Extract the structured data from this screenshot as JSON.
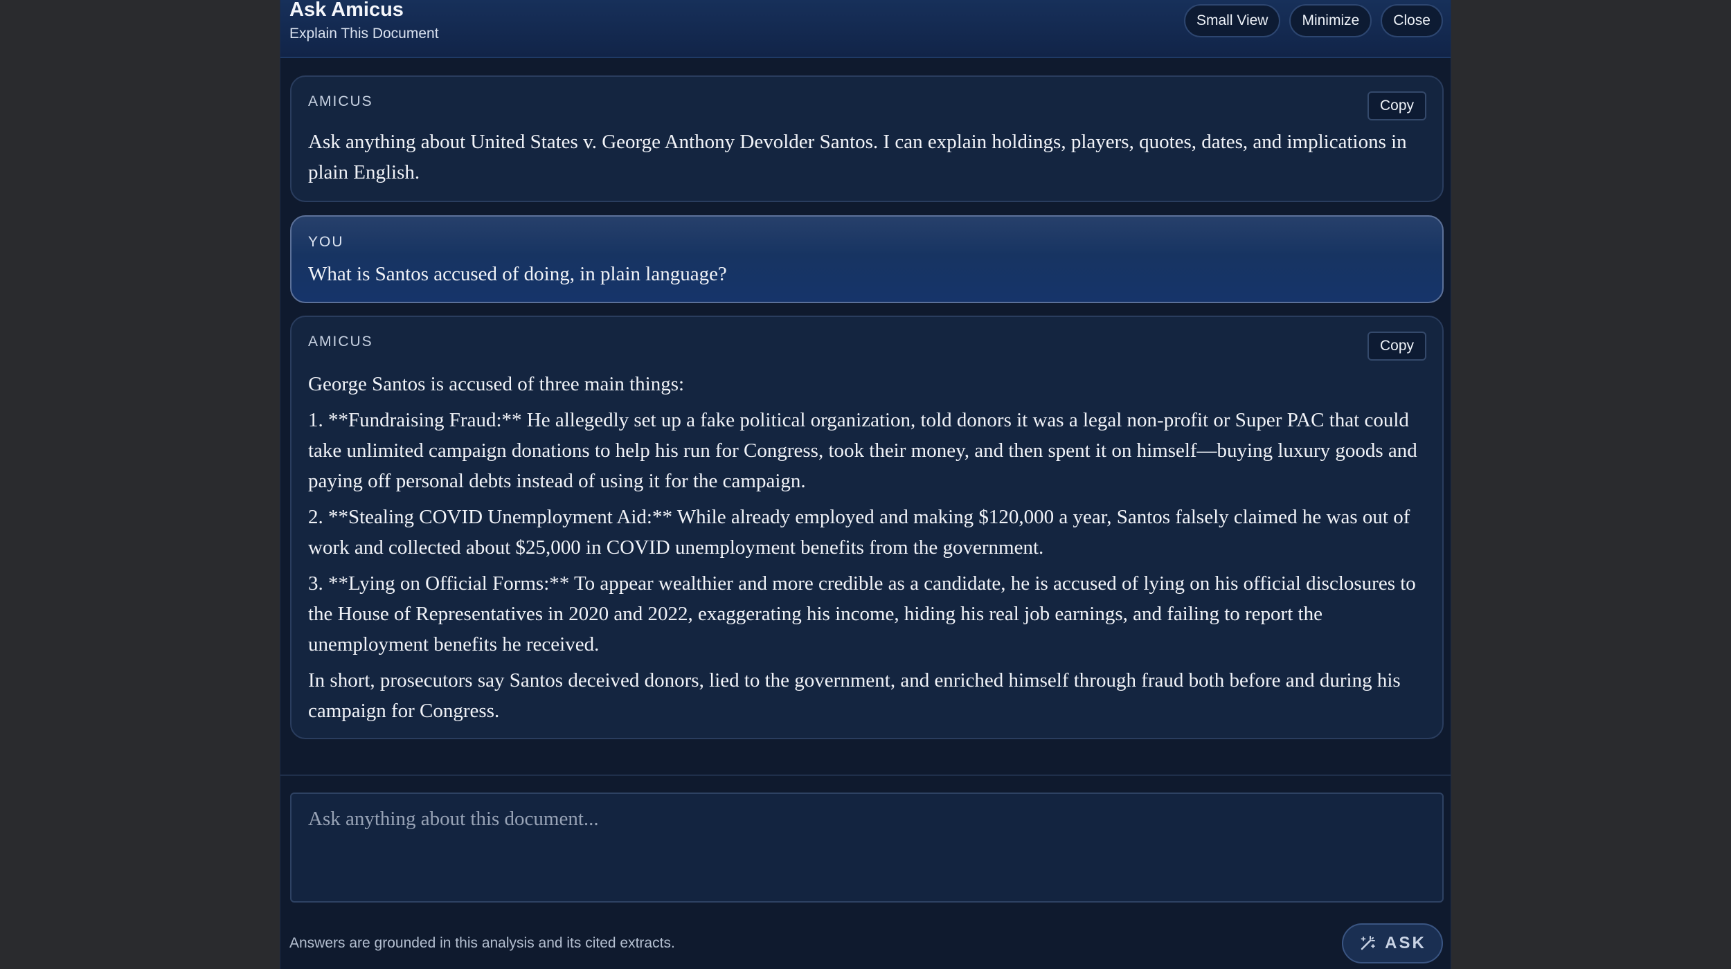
{
  "header": {
    "title": "Ask Amicus",
    "subtitle": "Explain This Document",
    "buttons": {
      "small_view": "Small View",
      "minimize": "Minimize",
      "close": "Close"
    }
  },
  "messages": [
    {
      "role": "AMICUS",
      "copy_label": "Copy",
      "paragraphs": [
        "Ask anything about United States v. George Anthony Devolder Santos. I can explain holdings, players, quotes, dates, and implications in plain English."
      ]
    },
    {
      "role": "YOU",
      "paragraphs": [
        "What is Santos accused of doing, in plain language?"
      ]
    },
    {
      "role": "AMICUS",
      "copy_label": "Copy",
      "paragraphs": [
        "George Santos is accused of three main things:",
        "1. **Fundraising Fraud:** He allegedly set up a fake political organization, told donors it was a legal non-profit or Super PAC that could take unlimited campaign donations to help his run for Congress, took their money, and then spent it on himself—buying luxury goods and paying off personal debts instead of using it for the campaign.",
        "2. **Stealing COVID Unemployment Aid:** While already employed and making $120,000 a year, Santos falsely claimed he was out of work and collected about $25,000 in COVID unemployment benefits from the government.",
        "3. **Lying on Official Forms:** To appear wealthier and more credible as a candidate, he is accused of lying on his official disclosures to the House of Representatives in 2020 and 2022, exaggerating his income, hiding his real job earnings, and failing to report the unemployment benefits he received.",
        "In short, prosecutors say Santos deceived donors, lied to the government, and enriched himself through fraud both before and during his campaign for Congress."
      ]
    }
  ],
  "composer": {
    "placeholder": "Ask anything about this document...",
    "value": ""
  },
  "footer": {
    "note": "Answers are grounded in this analysis and its cited extracts.",
    "ask_label": "ASK",
    "ask_icon": "magic-wand-icon"
  },
  "colors": {
    "panel_bg": "#0f1a2e",
    "header_bg": "#17305a",
    "user_bubble": "#16346a",
    "assistant_bubble": "#142540",
    "text": "#f1f3f8"
  }
}
